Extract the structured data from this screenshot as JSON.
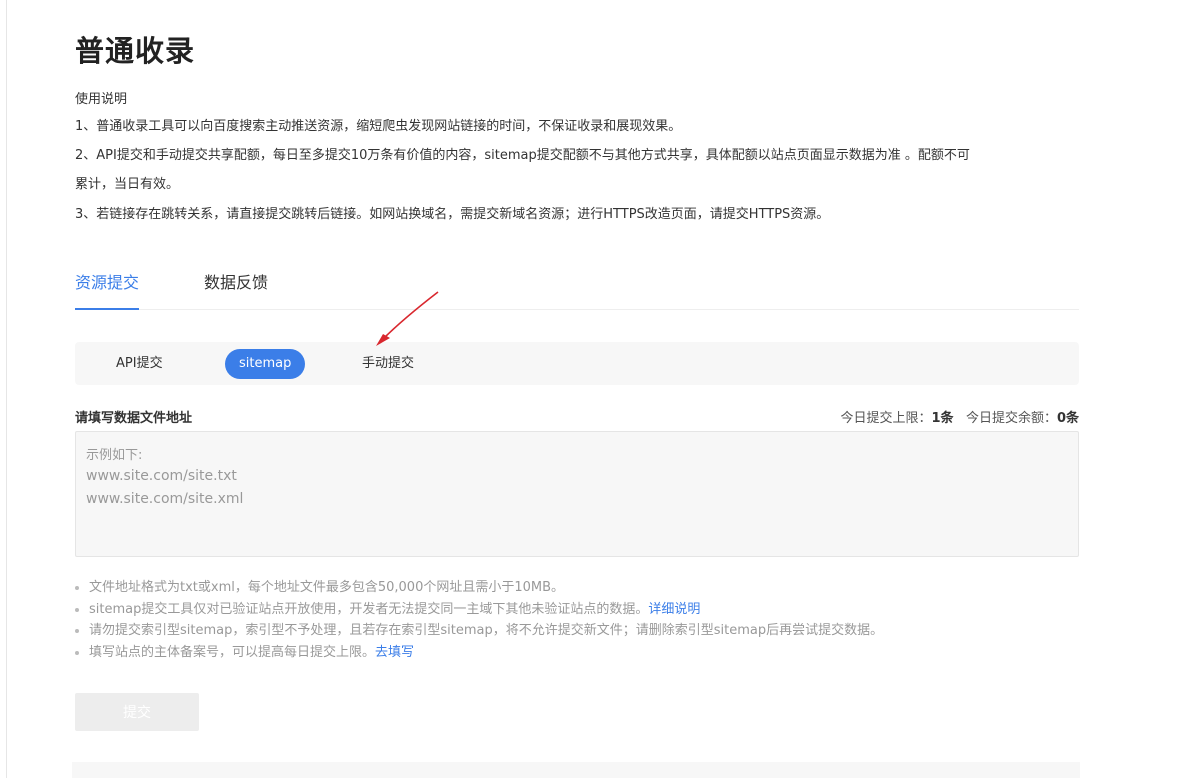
{
  "page": {
    "title": "普通收录",
    "usage_title": "使用说明",
    "usage_lines": [
      "1、普通收录工具可以向百度搜索主动推送资源，缩短爬虫发现网站链接的时间，不保证收录和展现效果。",
      "2、API提交和手动提交共享配额，每日至多提交10万条有价值的内容，sitemap提交配额不与其他方式共享，具体配额以站点页面显示数据为准 。配额不可",
      "累计，当日有效。",
      "3、若链接存在跳转关系，请直接提交跳转后链接。如网站换域名，需提交新域名资源；进行HTTPS改造页面，请提交HTTPS资源。"
    ]
  },
  "tabs": [
    {
      "label": "资源提交",
      "active": true
    },
    {
      "label": "数据反馈",
      "active": false
    }
  ],
  "subtabs": [
    {
      "label": "API提交"
    },
    {
      "label": "sitemap"
    },
    {
      "label": "手动提交"
    }
  ],
  "form": {
    "label": "请填写数据文件地址",
    "quota_limit_label": "今日提交上限：",
    "quota_limit_value": "1条",
    "quota_remain_label": "今日提交余额：",
    "quota_remain_value": "0条",
    "placeholder_lines": [
      "示例如下:",
      "www.site.com/site.txt",
      "www.site.com/site.xml"
    ],
    "submit_label": "提交"
  },
  "notes": [
    {
      "text": "文件地址格式为txt或xml，每个地址文件最多包含50,000个网址且需小于10MB。"
    },
    {
      "text": "sitemap提交工具仅对已验证站点开放使用，开发者无法提交同一主域下其他未验证站点的数据。",
      "link": "详细说明"
    },
    {
      "text": "请勿提交索引型sitemap，索引型不予处理，且若存在索引型sitemap，将不允许提交新文件；请删除索引型sitemap后再尝试提交数据。"
    },
    {
      "text": "填写站点的主体备案号，可以提高每日提交上限。",
      "link": "去填写"
    }
  ],
  "colors": {
    "accent": "#3b7ee8",
    "annotation_arrow": "#d9272e"
  },
  "icons": {
    "annotation": "red-arrow-icon"
  }
}
